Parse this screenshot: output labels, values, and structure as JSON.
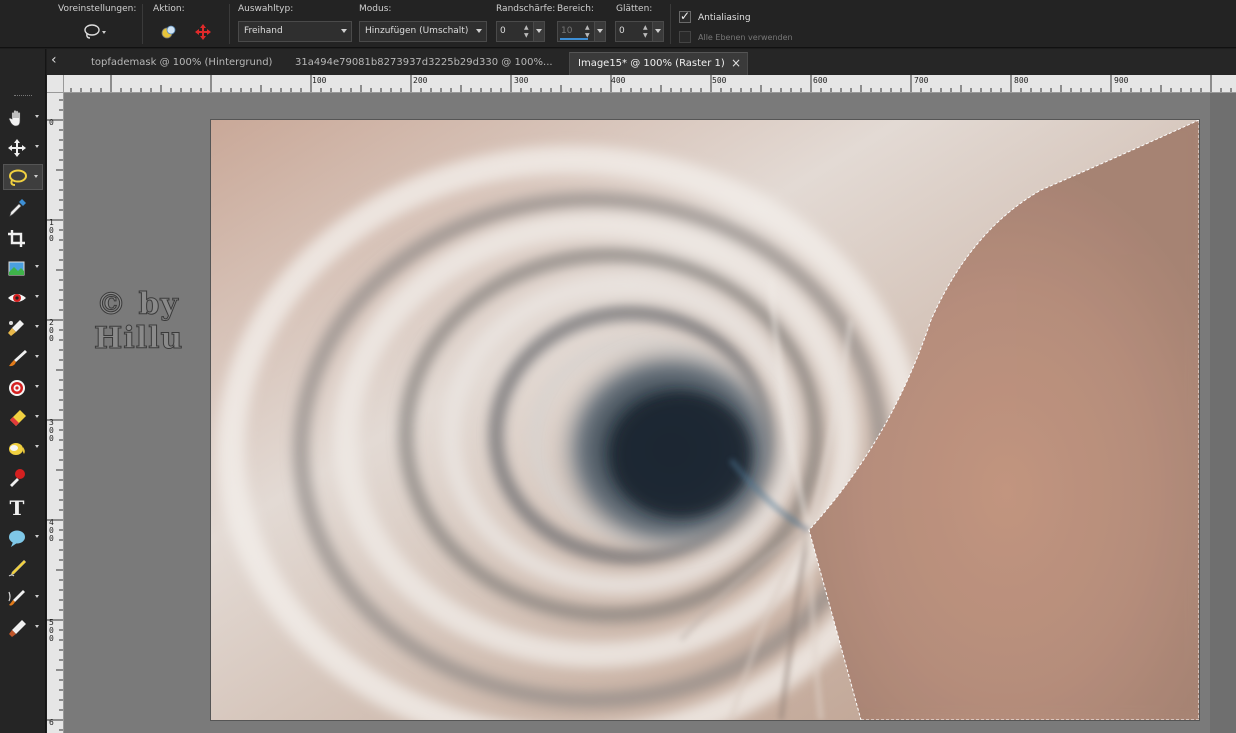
{
  "options_bar": {
    "presets_label": "Voreinstellungen:",
    "action_label": "Aktion:",
    "selection_type_label": "Auswahltyp:",
    "selection_type_value": "Freihand",
    "mode_label": "Modus:",
    "mode_value": "Hinzufügen (Umschalt)",
    "feather_label": "Randschärfe:",
    "feather_value": "0",
    "range_label": "Bereich:",
    "range_value": "10",
    "smoothing_label": "Glätten:",
    "smoothing_value": "0",
    "antialias_label": "Antialiasing",
    "antialias_checked": true,
    "all_layers_label": "Alle Ebenen verwenden",
    "all_layers_checked": false
  },
  "tabs": [
    {
      "label": "topfademask @ 100% (Hintergrund)",
      "active": false
    },
    {
      "label": "31a494e79081b8273937d3225b29d330  @  100%...",
      "active": false
    },
    {
      "label": "Image15* @ 100% (Raster 1)",
      "active": true
    }
  ],
  "tab_close": "×",
  "tab_back": "‹",
  "toolbar": [
    {
      "name": "pan-tool",
      "icon": "hand-icon",
      "has_more": true,
      "active": false
    },
    {
      "name": "move-tool",
      "icon": "move-icon",
      "has_more": true,
      "active": false
    },
    {
      "name": "selection-tool",
      "icon": "lasso-icon",
      "has_more": true,
      "active": true
    },
    {
      "name": "dropper-tool",
      "icon": "dropper-icon",
      "has_more": false,
      "active": false
    },
    {
      "name": "crop-tool",
      "icon": "crop-icon",
      "has_more": false,
      "active": false
    },
    {
      "name": "straighten-tool",
      "icon": "picture-tube-icon",
      "has_more": true,
      "active": false
    },
    {
      "name": "red-eye-tool",
      "icon": "eye-icon",
      "has_more": true,
      "active": false
    },
    {
      "name": "clone-tool",
      "icon": "clone-brush-icon",
      "has_more": true,
      "active": false
    },
    {
      "name": "paint-brush-tool",
      "icon": "brush-icon",
      "has_more": true,
      "active": false
    },
    {
      "name": "target-tool",
      "icon": "target-icon",
      "has_more": true,
      "active": false
    },
    {
      "name": "eraser-tool",
      "icon": "eraser-icon",
      "has_more": true,
      "active": false
    },
    {
      "name": "fill-tool",
      "icon": "paint-bucket-icon",
      "has_more": true,
      "active": false
    },
    {
      "name": "color-changer-tool",
      "icon": "color-changer-icon",
      "has_more": false,
      "active": false
    },
    {
      "name": "text-tool",
      "icon": "text-icon",
      "has_more": false,
      "active": false
    },
    {
      "name": "shape-tool",
      "icon": "speech-bubble-icon",
      "has_more": true,
      "active": false
    },
    {
      "name": "pen-tool",
      "icon": "pen-icon",
      "has_more": false,
      "active": false
    },
    {
      "name": "warp-brush-tool",
      "icon": "warp-brush-icon",
      "has_more": true,
      "active": false
    },
    {
      "name": "retouch-tool",
      "icon": "smudge-icon",
      "has_more": true,
      "active": false
    }
  ],
  "ruler_top_labels": [
    "100",
    "200",
    "300",
    "400",
    "500",
    "600",
    "700",
    "800",
    "900"
  ],
  "ruler_left_labels": [
    "0",
    "1 0 0",
    "2 0 0",
    "3 0 0",
    "4 0 0",
    "5 0 0",
    "6"
  ],
  "text_glyph": "T",
  "watermark_lines": [
    "© by",
    "Hillu"
  ],
  "colors": {
    "bg_dark": "#232323",
    "workspace": "#7a7a7a",
    "accent_blue": "#3d8fd6",
    "action_red": "#e02a2a"
  }
}
